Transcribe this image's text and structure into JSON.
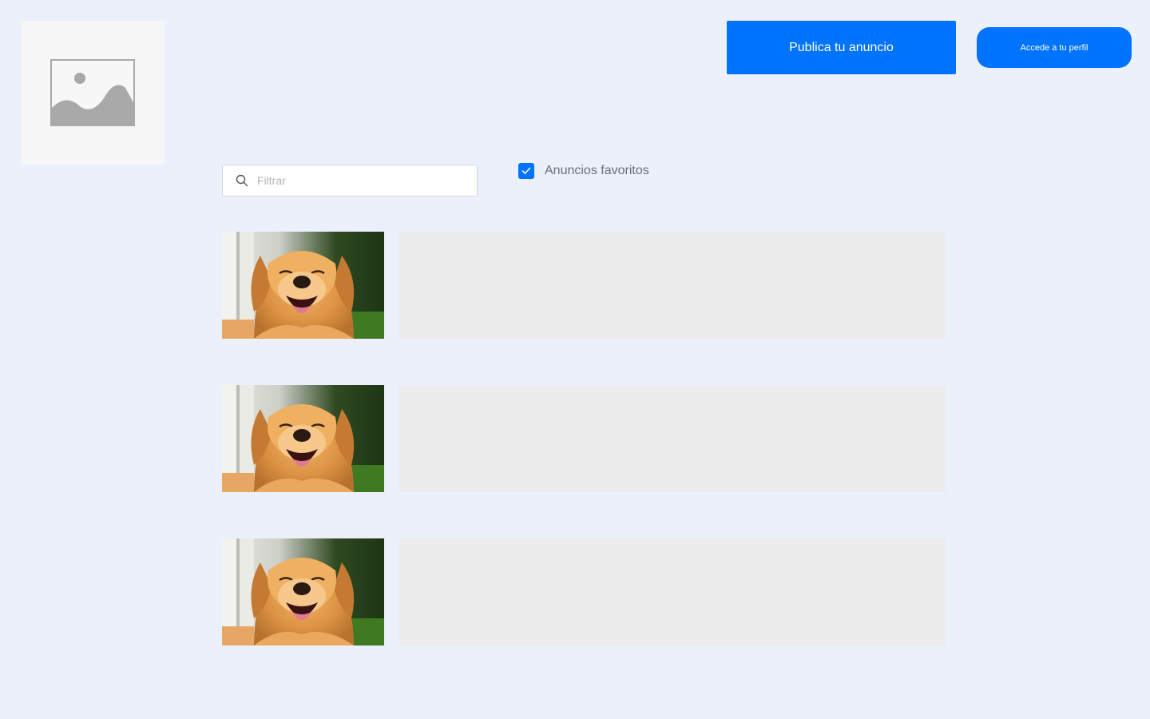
{
  "header": {
    "logo_icon": "image-placeholder-icon",
    "publish_label": "Publica tu anuncio",
    "profile_label": "Accede a tu perfil"
  },
  "filters": {
    "search_icon": "search-icon",
    "search_placeholder": "Filtrar",
    "search_value": "",
    "favorites_label": "Anuncios favoritos",
    "favorites_checked": true
  },
  "listings": [
    {
      "image_icon": "dog-photo"
    },
    {
      "image_icon": "dog-photo"
    },
    {
      "image_icon": "dog-photo"
    }
  ],
  "colors": {
    "background": "#ecf0fb",
    "accent": "#0073ff",
    "panel": "#ececec"
  }
}
